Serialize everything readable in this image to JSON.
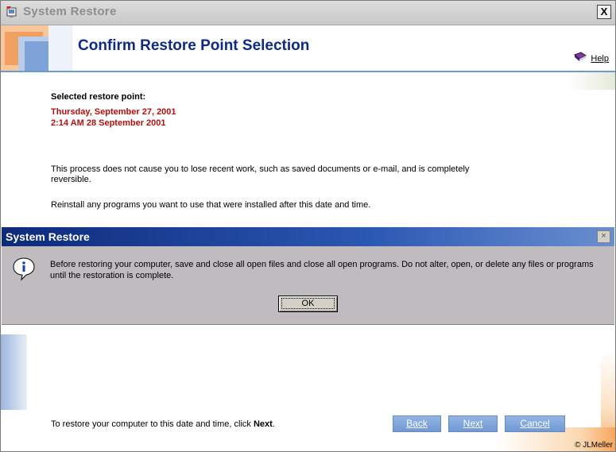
{
  "window": {
    "title": "System Restore",
    "close_glyph": "X"
  },
  "header": {
    "title": "Confirm Restore Point Selection",
    "help_label": "Help"
  },
  "selection": {
    "label": "Selected restore point:",
    "date": "Thursday, September 27, 2001",
    "time": "2:14 AM 28 September 2001"
  },
  "body": {
    "paragraph1": "This process does not cause you to lose recent work, such as saved documents or e-mail, and is completely reversible.",
    "paragraph2": "Reinstall any programs you want to use that were installed after this date and time."
  },
  "dialog": {
    "title": "System Restore",
    "close_glyph": "×",
    "icon": "information-icon",
    "message": "Before restoring your computer, save and close all open files and close all open programs. Do not alter, open, or delete any files or programs until the restoration is complete.",
    "ok_label": "OK"
  },
  "footer": {
    "instruction_prefix": "To restore your computer to this date and time, click ",
    "instruction_emphasis": "Next",
    "instruction_suffix": ".",
    "back_label": "Back",
    "next_label": "Next",
    "cancel_label": "Cancel",
    "copyright": "© JLMeller"
  },
  "colors": {
    "accent_title": "#102a82",
    "date_red": "#b01010",
    "dialog_title_bg": "#0e2a7a",
    "wizard_button": "#7aa0d8"
  }
}
